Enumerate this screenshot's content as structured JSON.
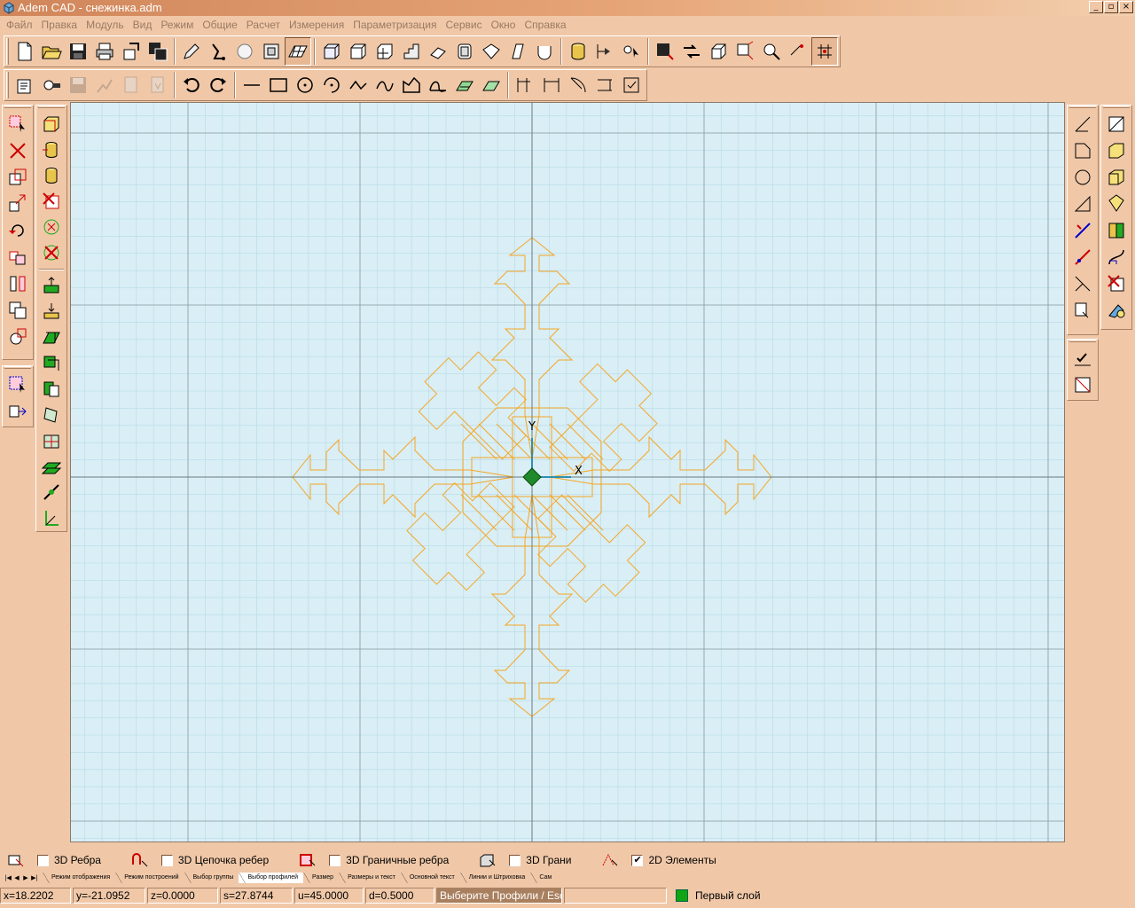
{
  "window": {
    "title": "Adem CAD - снежинка.adm",
    "min_label": "_",
    "max_label": "▫",
    "close_label": "×"
  },
  "menu": [
    "Файл",
    "Правка",
    "Модуль",
    "Вид",
    "Режим",
    "Общие",
    "Расчет",
    "Измерения",
    "Параметризация",
    "Сервис",
    "Окно",
    "Справка"
  ],
  "canvas": {
    "x_label": "X",
    "y_label": "Y",
    "shape_color": "#f5a623",
    "grid_minor": "#b8dbe7",
    "grid_major": "#8a9aa0",
    "background": "#d9eef5"
  },
  "filters": [
    {
      "label": "3D Ребра",
      "checked": false
    },
    {
      "label": "3D Цепочка ребер",
      "checked": false
    },
    {
      "label": "3D Граничные ребра",
      "checked": false
    },
    {
      "label": "3D Грани",
      "checked": false
    },
    {
      "label": "2D Элементы",
      "checked": true
    }
  ],
  "tabs": [
    "Режим отображения",
    "Режим построений",
    "Выбор группы",
    "Выбор профилей",
    "Размер",
    "Размеры и текст",
    "Основной текст",
    "Линии и Штриховка",
    "Сам"
  ],
  "active_tab": "Выбор профилей",
  "status": {
    "x": "x=18.2202",
    "y": "y=-21.0952",
    "z": "z=0.0000",
    "s": "s=27.8744",
    "u": "u=45.0000",
    "d": "d=0.5000",
    "hint": "Выберите Профили / Esc",
    "layer": "Первый слой",
    "layer_color": "#0fa515"
  }
}
